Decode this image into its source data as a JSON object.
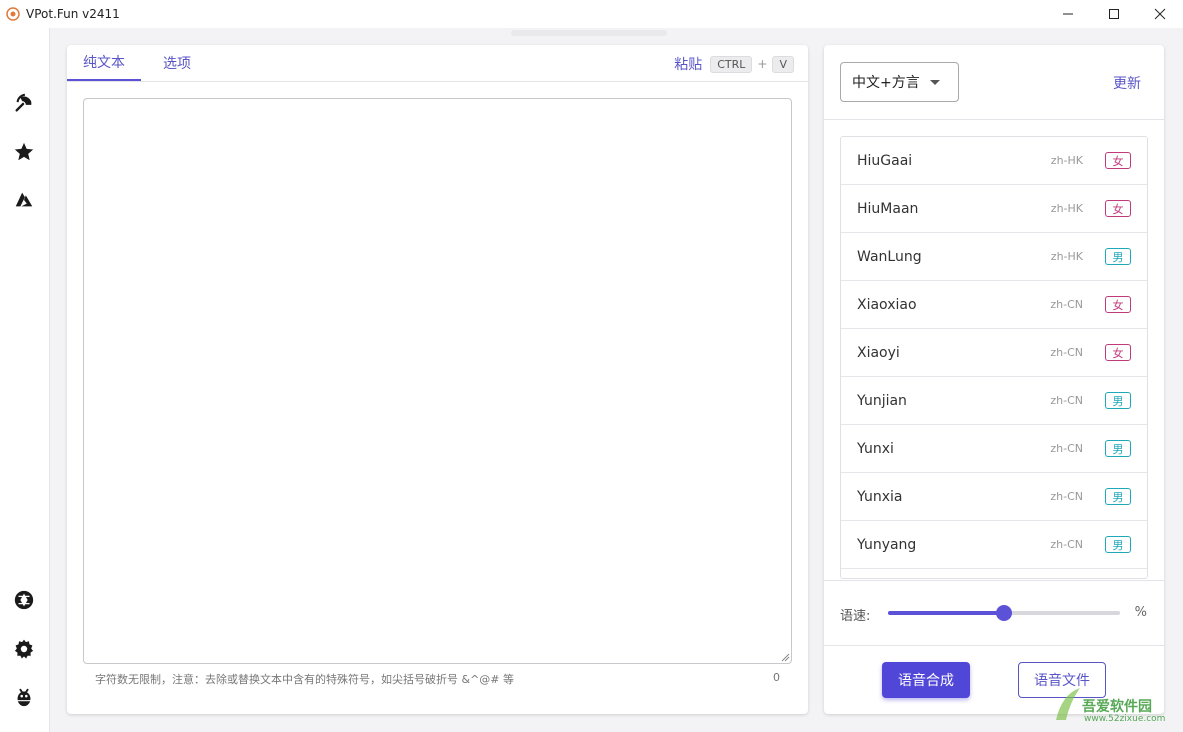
{
  "window": {
    "title": "VPot.Fun v2411"
  },
  "sidebar": {
    "items": [
      {
        "icon": "edge-tts-icon"
      },
      {
        "icon": "star-icon"
      },
      {
        "icon": "azure-icon"
      },
      {
        "icon": "aperture-icon"
      },
      {
        "icon": "gear-icon"
      },
      {
        "icon": "bug-icon"
      }
    ]
  },
  "editor": {
    "tabs": [
      {
        "label": "纯文本",
        "active": true
      },
      {
        "label": "选项",
        "active": false
      }
    ],
    "paste": {
      "label": "粘贴",
      "key1": "CTRL",
      "plus": "+",
      "key2": "V"
    },
    "text_value": "",
    "hint": "字符数无限制，注意：去除或替换文本中含有的特殊符号，如尖括号破折号 &^@# 等",
    "char_count": "0"
  },
  "voices": {
    "language_select": "中文+方言",
    "update_label": "更新",
    "items": [
      {
        "name": "HiuGaai",
        "locale": "zh-HK",
        "gender": "女"
      },
      {
        "name": "HiuMaan",
        "locale": "zh-HK",
        "gender": "女"
      },
      {
        "name": "WanLung",
        "locale": "zh-HK",
        "gender": "男"
      },
      {
        "name": "Xiaoxiao",
        "locale": "zh-CN",
        "gender": "女"
      },
      {
        "name": "Xiaoyi",
        "locale": "zh-CN",
        "gender": "女"
      },
      {
        "name": "Yunjian",
        "locale": "zh-CN",
        "gender": "男"
      },
      {
        "name": "Yunxi",
        "locale": "zh-CN",
        "gender": "男"
      },
      {
        "name": "Yunxia",
        "locale": "zh-CN",
        "gender": "男"
      },
      {
        "name": "Yunyang",
        "locale": "zh-CN",
        "gender": "男"
      }
    ]
  },
  "speed": {
    "label": "语速:",
    "value_fraction": 0.5,
    "unit": "%"
  },
  "actions": {
    "synthesize_label": "语音合成",
    "file_label": "语音文件"
  },
  "watermark": {
    "brand": "吾爱软件园",
    "url": "www.52zixue.com"
  },
  "colors": {
    "accent": "#5b52d8",
    "female": "#c03a7a",
    "male": "#1ea8b8"
  }
}
